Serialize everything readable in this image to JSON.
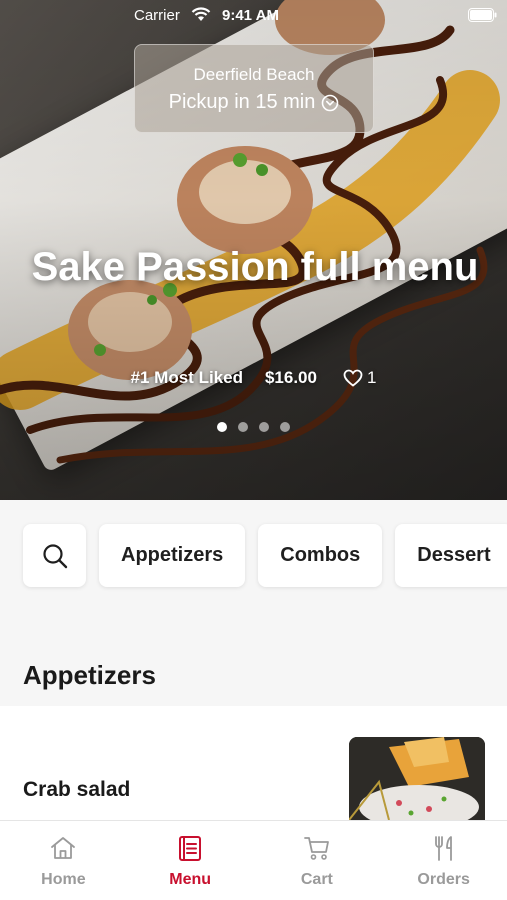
{
  "status_bar": {
    "carrier": "Carrier",
    "time": "9:41 AM"
  },
  "location": {
    "city": "Deerfield Beach",
    "pickup": "Pickup in 15 min"
  },
  "hero": {
    "title": "Sake Passion full menu",
    "badge": "#1 Most Liked",
    "price": "$16.00",
    "likes": "1",
    "slide_count": 4,
    "active_slide": 1
  },
  "categories": [
    "Appetizers",
    "Combos",
    "Dessert"
  ],
  "section": {
    "title": "Appetizers"
  },
  "menu_items": [
    {
      "name": "Crab salad"
    }
  ],
  "tabs": [
    {
      "label": "Home",
      "icon": "home-icon"
    },
    {
      "label": "Menu",
      "icon": "menu-book-icon"
    },
    {
      "label": "Cart",
      "icon": "cart-icon"
    },
    {
      "label": "Orders",
      "icon": "fork-knife-icon"
    }
  ],
  "active_tab": "Menu",
  "colors": {
    "accent": "#c8102e",
    "inactive": "#9a9a9a",
    "background": "#f6f6f6"
  }
}
